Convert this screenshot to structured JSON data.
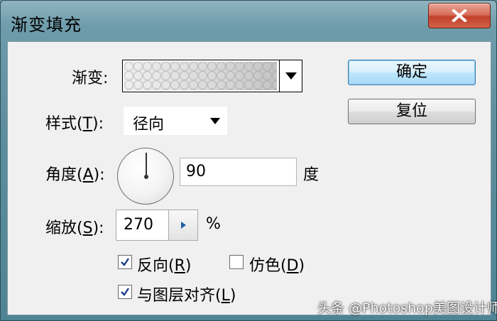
{
  "window": {
    "title": "渐变填充",
    "close_icon": "close-x-icon"
  },
  "gradient": {
    "label": "渐变:",
    "dropdown_icon": "triangle-down-icon"
  },
  "style": {
    "label_prefix": "样式(",
    "label_key": "T",
    "label_suffix": "):",
    "value": "径向",
    "dropdown_icon": "triangle-down-icon"
  },
  "angle": {
    "label_prefix": "角度(",
    "label_key": "A",
    "label_suffix": "):",
    "value": "90",
    "unit": "度"
  },
  "scale": {
    "label_prefix": "缩放(",
    "label_key": "S",
    "label_suffix": "):",
    "value": "270",
    "unit": "%",
    "stepper_icon": "triangle-right-icon"
  },
  "options": {
    "reverse": {
      "label_prefix": "反向(",
      "label_key": "R",
      "label_suffix": ")",
      "checked": true
    },
    "dither": {
      "label_prefix": "仿色(",
      "label_key": "D",
      "label_suffix": ")",
      "checked": false
    },
    "align_with_layer": {
      "label_prefix": "与图层对齐(",
      "label_key": "L",
      "label_suffix": ")",
      "checked": true
    }
  },
  "buttons": {
    "ok": "确定",
    "reset": "复位"
  },
  "watermark": "头条 @Photoshop美图设计师",
  "colors": {
    "title_bar": "#6e9cab",
    "close_button": "#c2412a",
    "default_button": "#bee6fd",
    "dialog_bg": "#f0f0f0"
  }
}
